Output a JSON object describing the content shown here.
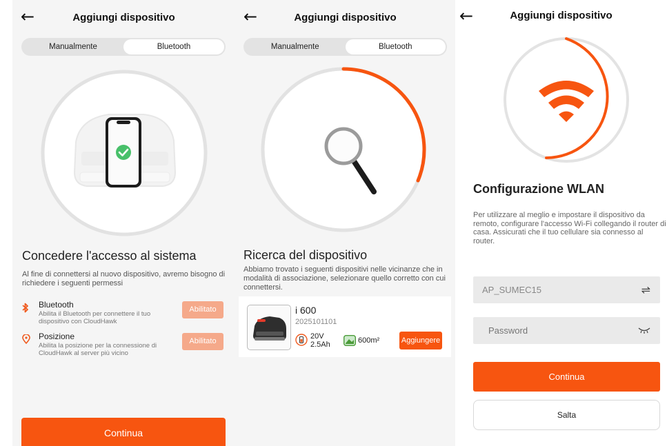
{
  "colors": {
    "accent": "#f75510",
    "accent_light": "#f5a98a",
    "bg": "#f5f5f5"
  },
  "screen1": {
    "title": "Aggiungi dispositivo",
    "tabs": [
      "Manualmente",
      "Bluetooth"
    ],
    "heading": "Concedere l'accesso al sistema",
    "intro": "Al fine di connettersi al nuovo dispositivo, avremo bisogno di richiedere i seguenti permessi",
    "permissions": [
      {
        "icon": "bluetooth-icon",
        "title": "Bluetooth",
        "desc": "Abilita il Bluetooth per connettere il tuo dispositivo con CloudHawk",
        "button": "Abilitato"
      },
      {
        "icon": "location-pin-icon",
        "title": "Posizione",
        "desc": "Abilita la posizione per la connessione di CloudHawk al server più vicino",
        "button": "Abilitato"
      }
    ],
    "continue": "Continua"
  },
  "screen2": {
    "title": "Aggiungi dispositivo",
    "tabs": [
      "Manualmente",
      "Bluetooth"
    ],
    "heading": "Ricerca del dispositivo",
    "intro": "Abbiamo trovato i seguenti dispositivi nelle vicinanze che in modalità di associazione, selezionare quello corretto con cui connettersi.",
    "device": {
      "name": "i 600",
      "serial": "2025101101",
      "voltage": "20V",
      "capacity": "2.5Ah",
      "area": "600m²",
      "add_button": "Aggiungere"
    }
  },
  "screen3": {
    "title": "Aggiungi dispositivo",
    "heading": "Configurazione WLAN",
    "intro": "Per utilizzare al meglio e impostare il dispositivo da remoto, configurare l'accesso Wi-Fi collegando il router di casa. Assicurati che il tuo cellulare sia connesso al router.",
    "ssid": "AP_SUMEC15",
    "password_placeholder": "Password",
    "continue": "Continua",
    "skip": "Salta"
  }
}
